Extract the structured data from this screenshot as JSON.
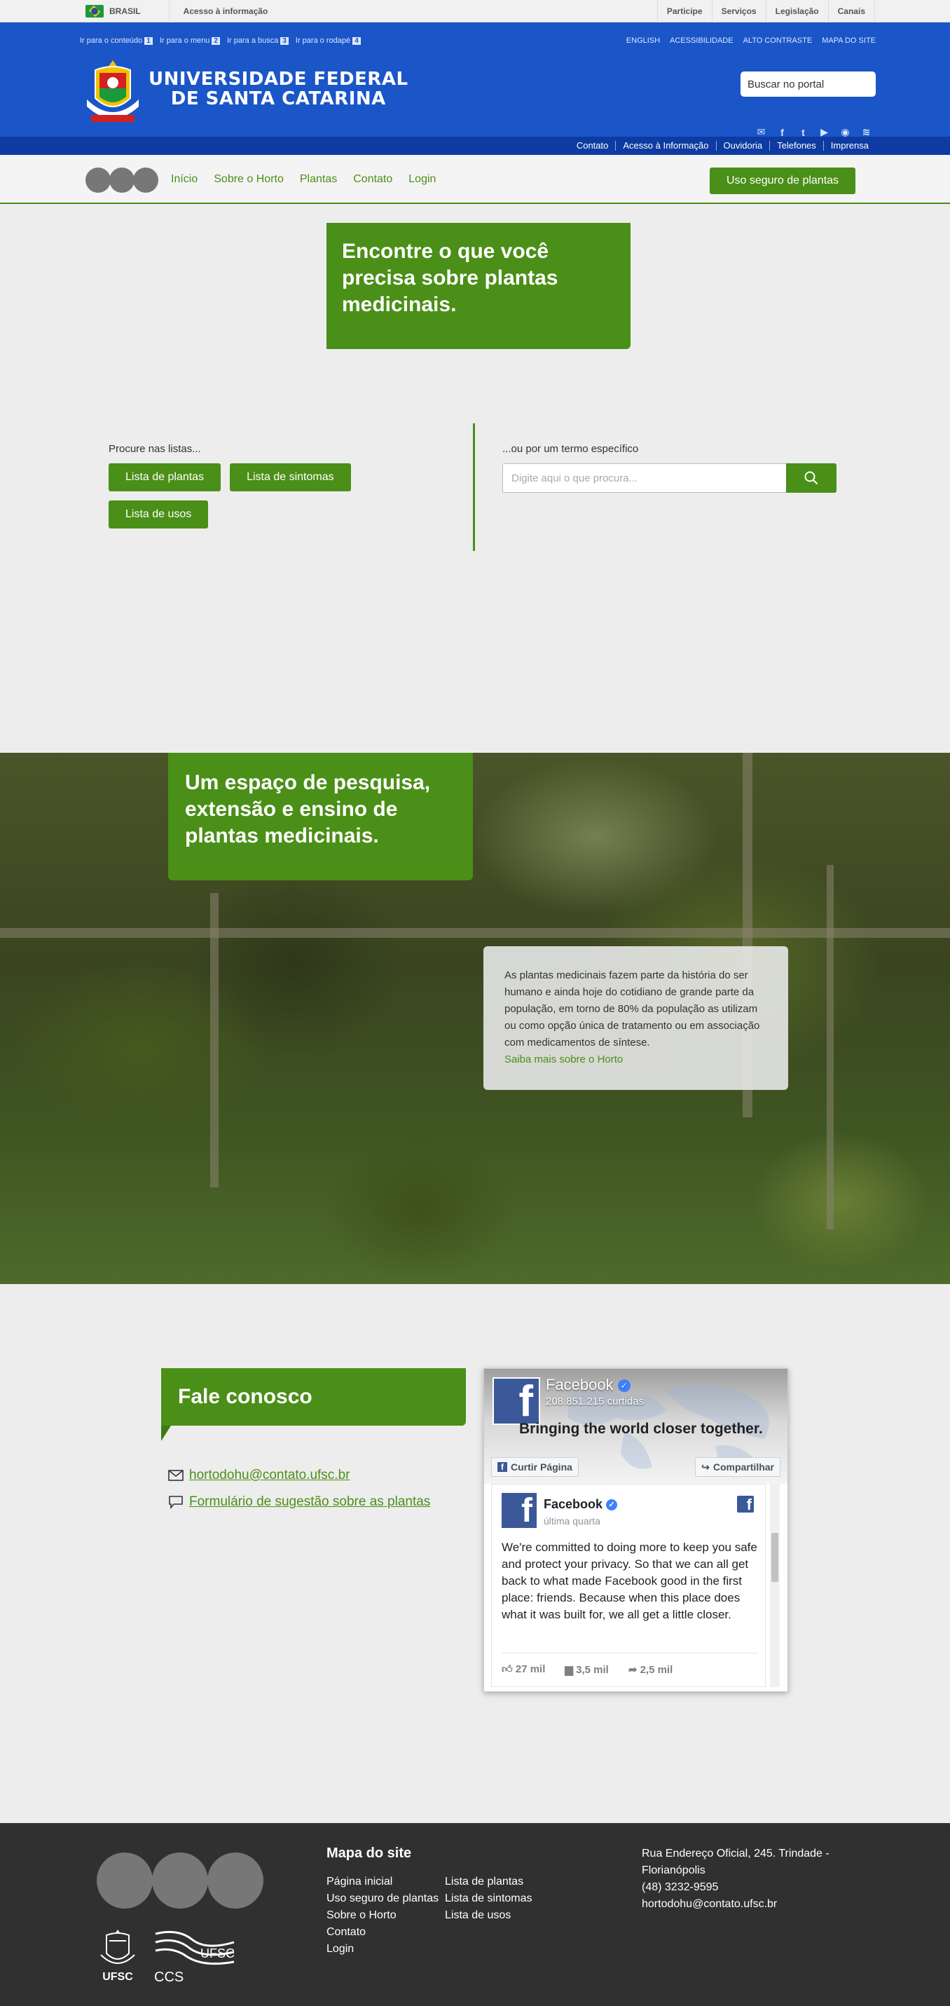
{
  "gov_bar": {
    "country": "BRASIL",
    "access_info": "Acesso à informação",
    "links": [
      "Participe",
      "Serviços",
      "Legislação",
      "Canais"
    ]
  },
  "header": {
    "skip_links": [
      {
        "label": "Ir para o conteúdo",
        "num": "1"
      },
      {
        "label": "Ir para o menu",
        "num": "2"
      },
      {
        "label": "Ir para a busca",
        "num": "3"
      },
      {
        "label": "Ir para o rodapé",
        "num": "4"
      }
    ],
    "top_links": [
      "ENGLISH",
      "ACESSIBILIDADE",
      "ALTO CONTRASTE",
      "MAPA DO SITE"
    ],
    "university_line1": "UNIVERSIDADE FEDERAL",
    "university_line2": "DE SANTA CATARINA",
    "search_placeholder": "Buscar no portal",
    "social_icons": [
      "mail-icon",
      "facebook-icon",
      "twitter-icon",
      "youtube-icon",
      "instagram-icon",
      "rss-icon"
    ],
    "utility_links": [
      "Contato",
      "Acesso à Informação",
      "Ouvidoria",
      "Telefones",
      "Imprensa"
    ]
  },
  "nav": {
    "links": [
      "Início",
      "Sobre o Horto",
      "Plantas",
      "Contato",
      "Login"
    ],
    "cta": "Uso seguro de plantas"
  },
  "hero": {
    "title": "Encontre o que você precisa sobre plantas medicinais."
  },
  "search": {
    "left_label": "Procure nas listas...",
    "list_buttons": [
      "Lista de plantas",
      "Lista de sintomas",
      "Lista de usos"
    ],
    "right_label": "...ou por um termo específico",
    "term_placeholder": "Digite aqui o que procura..."
  },
  "garden": {
    "title": "Um espaço de pesquisa, extensão e ensino de plantas medicinais.",
    "text": "As plantas medicinais fazem parte da história do ser humano e ainda hoje do cotidiano de grande parte da população, em torno de 80% da população as utilizam ou como opção única de tratamento ou em associação com medicamentos de síntese.",
    "link": "Saiba mais sobre o Horto"
  },
  "contact": {
    "title": "Fale conosco",
    "email": "hortodohu@contato.ufsc.br",
    "form_link": "Formulário de sugestão sobre as plantas"
  },
  "facebook": {
    "page_name": "Facebook",
    "likes": "208.851.215 curtidas",
    "tagline": "Bringing the world closer together.",
    "like_button": "Curtir Página",
    "share_button": "Compartilhar",
    "post_author": "Facebook",
    "post_date": "última quarta",
    "post_text": "We're committed to doing more to keep you safe and protect your privacy. So that we can all get back to what made Facebook good in the first place: friends. Because when this place does what it was built for, we all get a little closer.",
    "reactions": "27 mil",
    "comments": "3,5 mil",
    "shares": "2,5 mil"
  },
  "footer": {
    "sitemap_title": "Mapa do site",
    "sitemap_col1": [
      "Página inicial",
      "Uso seguro de plantas",
      "Sobre o Horto",
      "Contato",
      "Login"
    ],
    "sitemap_col2": [
      "Lista de plantas",
      "Lista de sintomas",
      "Lista de usos"
    ],
    "address_line1": "Rua Endereço Oficial, 245. Trindade - Florianópolis",
    "phone": "(48) 3232-9595",
    "email": "hortodohu@contato.ufsc.br",
    "logo_ufsc": "UFSC",
    "logo_ccs": "CCS",
    "logo_ccs_ufsc": "UFSC"
  },
  "colors": {
    "gov_blue": "#1b56c8",
    "gov_dark_blue": "#0d3ba1",
    "accent_green": "#4a8f17",
    "footer_bg": "#303030",
    "page_bg": "#ededed"
  }
}
